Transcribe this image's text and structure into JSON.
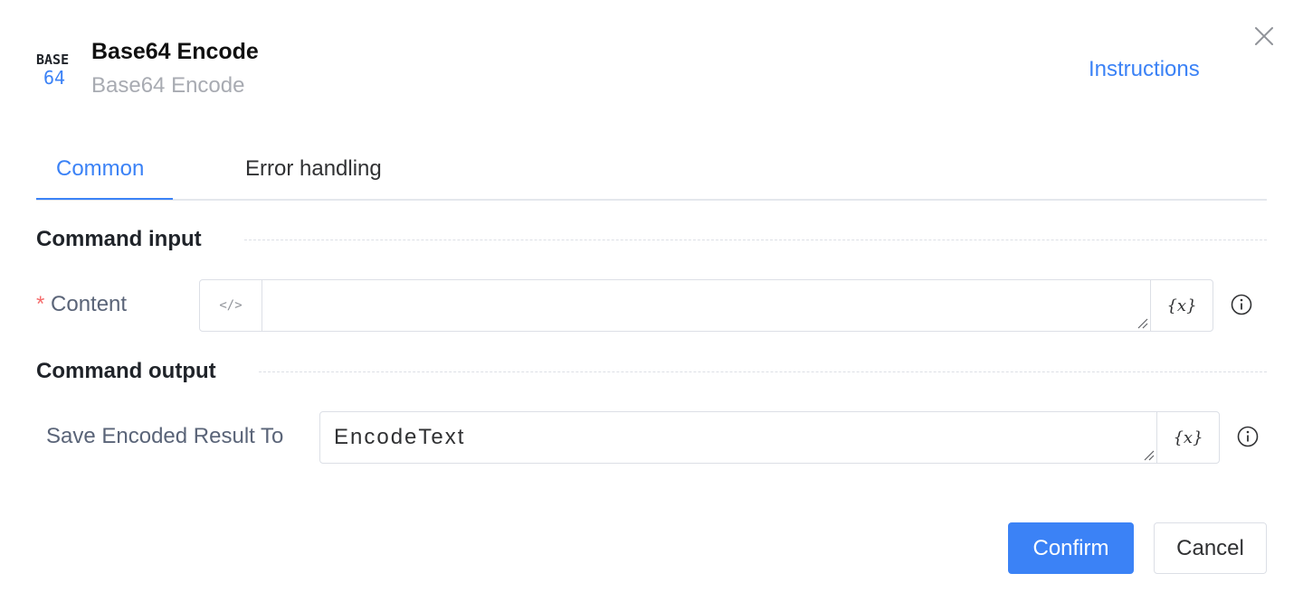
{
  "header": {
    "logo_top": "BASE",
    "logo_bottom": "64",
    "title": "Base64 Encode",
    "subtitle": "Base64 Encode",
    "instructions": "Instructions"
  },
  "tabs": [
    {
      "label": "Common",
      "active": true
    },
    {
      "label": "Error handling",
      "active": false
    }
  ],
  "sections": {
    "input_title": "Command input",
    "output_title": "Command output"
  },
  "content_field": {
    "required_mark": "*",
    "label": "Content",
    "value": "",
    "prefix_icon": "code-icon",
    "prefix_text": "</>",
    "variable_button": "{x}"
  },
  "output_field": {
    "label": "Save Encoded Result To",
    "value": "EncodeText",
    "variable_button": "{x}"
  },
  "footer": {
    "confirm": "Confirm",
    "cancel": "Cancel"
  },
  "colors": {
    "accent": "#3b82f6",
    "required": "#f56c6c"
  }
}
